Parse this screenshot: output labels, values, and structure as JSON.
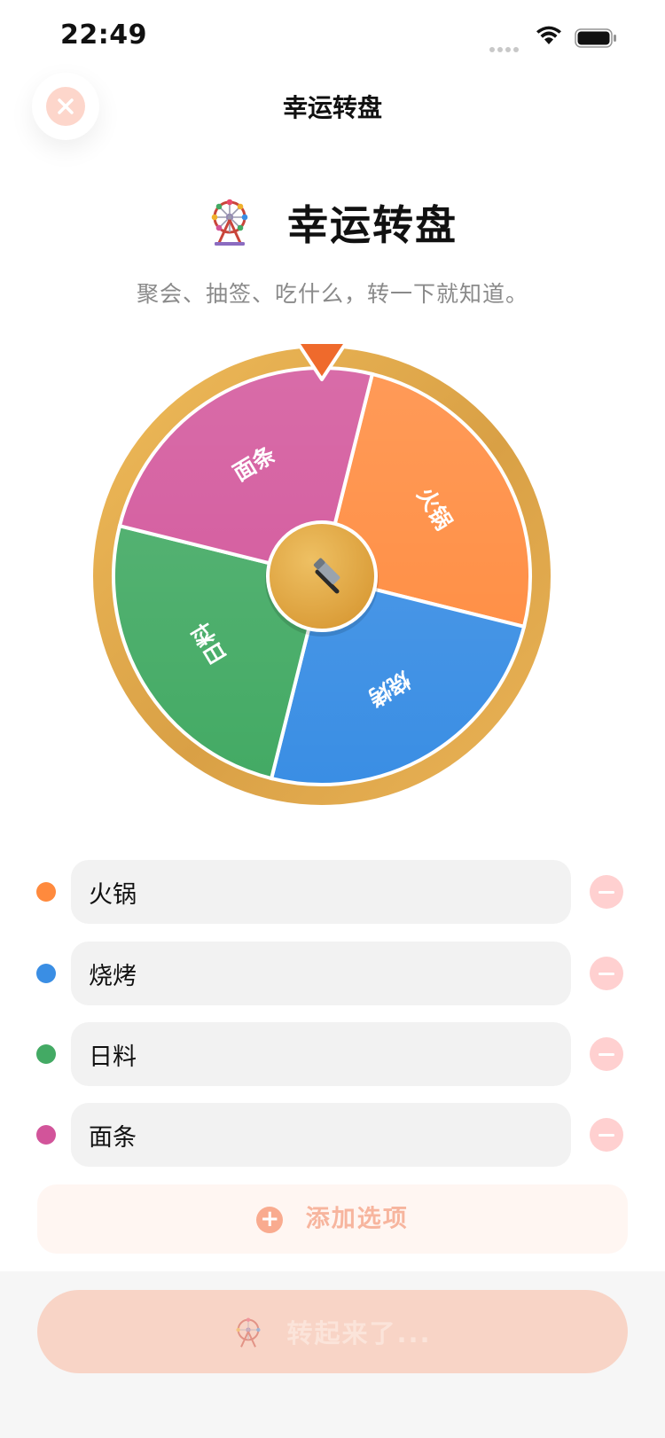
{
  "status": {
    "time": "22:49"
  },
  "nav": {
    "title": "幸运转盘"
  },
  "hero": {
    "title": "幸运转盘",
    "icon": "ferris-wheel-icon"
  },
  "subtitle": "聚会、抽签、吃什么，转一下就知道。",
  "wheel": {
    "center_icon": "hammer-icon",
    "rim_color": "#e2ad50",
    "pointer_color": "#ef6a2c",
    "segments": [
      {
        "label": "火锅",
        "color": "#ff8a3d"
      },
      {
        "label": "烧烤",
        "color": "#3a8ee4"
      },
      {
        "label": "日料",
        "color": "#43aa64"
      },
      {
        "label": "面条",
        "color": "#d2549a"
      }
    ]
  },
  "options": [
    {
      "value": "火锅",
      "color": "#ff8a3d"
    },
    {
      "value": "烧烤",
      "color": "#3a8ee4"
    },
    {
      "value": "日料",
      "color": "#43aa64"
    },
    {
      "value": "面条",
      "color": "#d2549a"
    }
  ],
  "add_button": {
    "label": "添加选项"
  },
  "spin_button": {
    "label": "转起来了..."
  },
  "colors": {
    "accent": "#f9ab8f",
    "remove": "#ffd0d0",
    "field_bg": "#f2f2f2"
  }
}
